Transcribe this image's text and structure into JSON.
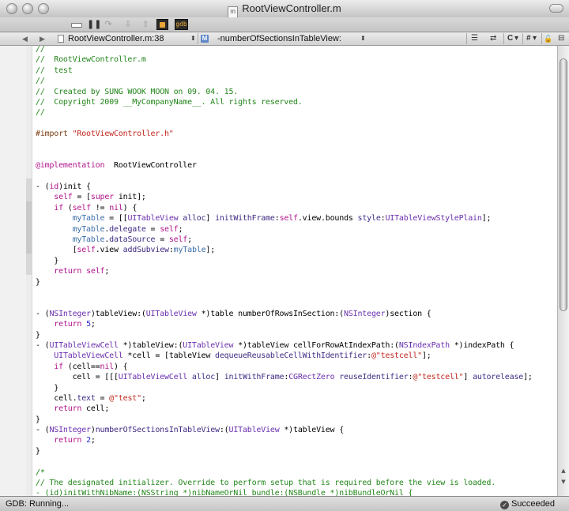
{
  "window": {
    "title": "RootViewController.m",
    "title_doc_badge": "m"
  },
  "toolbar": {
    "broom_icon": "clear-console-icon",
    "pause_glyph": "❚❚",
    "step_over_glyph": "↷",
    "step_into_glyph": "⇩",
    "step_out_glyph": "⇧",
    "gdb_label": "gdb"
  },
  "navbar": {
    "back_glyph": "◀",
    "forward_glyph": "▶",
    "file_label": "RootViewController.m:38",
    "popup_caret": "⬍",
    "method_badge": "M",
    "function_label": "-numberOfSectionsInTableView:",
    "counterparts_glyph": "⇄",
    "bookmarks_glyph": "☰",
    "language_label": "C",
    "pragma_label": "#",
    "lock_glyph": "🔓",
    "split_glyph": "⊟",
    "dropdown_glyph": "▾"
  },
  "editor": {
    "lines": [
      [
        [
          "c",
          "//"
        ]
      ],
      [
        [
          "c",
          "//  RootViewController.m"
        ]
      ],
      [
        [
          "c",
          "//  test"
        ]
      ],
      [
        [
          "c",
          "//"
        ]
      ],
      [
        [
          "c",
          "//  Created by SUNG WOOK MOON on 09. 04. 15."
        ]
      ],
      [
        [
          "c",
          "//  Copyright 2009 __MyCompanyName__. All rights reserved."
        ]
      ],
      [
        [
          "c",
          "//"
        ]
      ],
      [],
      [
        [
          "p",
          "#import "
        ],
        [
          "s",
          "\"RootViewController.h\""
        ]
      ],
      [],
      [],
      [
        [
          "k",
          "@implementation"
        ],
        [
          "",
          "  RootViewController"
        ]
      ],
      [],
      [
        [
          "",
          "- ("
        ],
        [
          "k",
          "id"
        ],
        [
          "",
          ")init {"
        ]
      ],
      [
        [
          "",
          "    "
        ],
        [
          "k",
          "self"
        ],
        [
          "",
          " = ["
        ],
        [
          "k",
          "super"
        ],
        [
          "",
          " init];"
        ]
      ],
      [
        [
          "",
          "    "
        ],
        [
          "k",
          "if"
        ],
        [
          "",
          " ("
        ],
        [
          "k",
          "self"
        ],
        [
          "",
          " != "
        ],
        [
          "k",
          "nil"
        ],
        [
          "",
          ") {"
        ]
      ],
      [
        [
          "",
          "        "
        ],
        [
          "v",
          "myTable"
        ],
        [
          "",
          " = [["
        ],
        [
          "t",
          "UITableView"
        ],
        [
          "",
          ""
        ],
        [
          "",
          " "
        ],
        [
          "m",
          "alloc"
        ],
        [
          "",
          "] "
        ],
        [
          "m",
          "initWithFrame"
        ],
        [
          "",
          ":"
        ],
        [
          "k",
          "self"
        ],
        [
          "",
          ".view.bounds "
        ],
        [
          "m",
          "style"
        ],
        [
          "",
          ":"
        ],
        [
          "t",
          "UITableViewStylePlain"
        ],
        [
          "",
          "];"
        ]
      ],
      [
        [
          "",
          "        "
        ],
        [
          "v",
          "myTable"
        ],
        [
          "",
          "."
        ],
        [
          "m",
          "delegate"
        ],
        [
          "",
          " = "
        ],
        [
          "k",
          "self"
        ],
        [
          "",
          ";"
        ]
      ],
      [
        [
          "",
          "        "
        ],
        [
          "v",
          "myTable"
        ],
        [
          "",
          "."
        ],
        [
          "m",
          "dataSource"
        ],
        [
          "",
          " = "
        ],
        [
          "k",
          "self"
        ],
        [
          "",
          ";"
        ]
      ],
      [
        [
          "",
          "        ["
        ],
        [
          "k",
          "self"
        ],
        [
          "",
          ".view "
        ],
        [
          "m",
          "addSubview"
        ],
        [
          "",
          ":"
        ],
        [
          "v",
          "myTable"
        ],
        [
          "",
          "];"
        ]
      ],
      [
        [
          "",
          "    }"
        ]
      ],
      [
        [
          "",
          "    "
        ],
        [
          "k",
          "return"
        ],
        [
          "",
          " "
        ],
        [
          "k",
          "self"
        ],
        [
          "",
          ";"
        ]
      ],
      [
        [
          "",
          "}"
        ]
      ],
      [],
      [],
      [
        [
          "",
          "- ("
        ],
        [
          "t",
          "NSInteger"
        ],
        [
          "",
          ")tableView:("
        ],
        [
          "t",
          "UITableView"
        ],
        [
          "",
          " *)table numberOfRowsInSection:("
        ],
        [
          "t",
          "NSInteger"
        ],
        [
          "",
          ")section {"
        ]
      ],
      [
        [
          "",
          "    "
        ],
        [
          "k",
          "return"
        ],
        [
          "",
          " "
        ],
        [
          "n",
          "5"
        ],
        [
          "",
          ";"
        ]
      ],
      [
        [
          "",
          "}"
        ]
      ],
      [
        [
          "",
          "- ("
        ],
        [
          "t",
          "UITableViewCell"
        ],
        [
          "",
          " *)tableView:("
        ],
        [
          "t",
          "UITableView"
        ],
        [
          "",
          " *)tableView cellForRowAtIndexPath:("
        ],
        [
          "t",
          "NSIndexPath"
        ],
        [
          "",
          " *)indexPath {"
        ]
      ],
      [
        [
          "",
          "    "
        ],
        [
          "t",
          "UITableViewCell"
        ],
        [
          "",
          " *cell = [tableView "
        ],
        [
          "m",
          "dequeueReusableCellWithIdentifier"
        ],
        [
          "",
          ":"
        ],
        [
          "s",
          "@\"testcell\""
        ],
        [
          "",
          "];"
        ]
      ],
      [
        [
          "",
          "    "
        ],
        [
          "k",
          "if"
        ],
        [
          "",
          " (cell=="
        ],
        [
          "k",
          "nil"
        ],
        [
          "",
          ") {"
        ]
      ],
      [
        [
          "",
          "        cell = [[["
        ],
        [
          "t",
          "UITableViewCell"
        ],
        [
          "",
          " "
        ],
        [
          "m",
          "alloc"
        ],
        [
          "",
          "] "
        ],
        [
          "m",
          "initWithFrame"
        ],
        [
          "",
          ":"
        ],
        [
          "t",
          "CGRectZero"
        ],
        [
          "",
          " "
        ],
        [
          "m",
          "reuseIdentifier"
        ],
        [
          "",
          ":"
        ],
        [
          "s",
          "@\"testcell\""
        ],
        [
          "",
          "] "
        ],
        [
          "m",
          "autorelease"
        ],
        [
          "",
          "];"
        ]
      ],
      [
        [
          "",
          "    }"
        ]
      ],
      [
        [
          "",
          "    cell."
        ],
        [
          "m",
          "text"
        ],
        [
          "",
          " = "
        ],
        [
          "s",
          "@\"test\""
        ],
        [
          "",
          ";"
        ]
      ],
      [
        [
          "",
          "    "
        ],
        [
          "k",
          "return"
        ],
        [
          "",
          " cell;"
        ]
      ],
      [
        [
          "",
          "}"
        ]
      ],
      [
        [
          "",
          "- ("
        ],
        [
          "t",
          "NSInteger"
        ],
        [
          "",
          ")"
        ],
        [
          "m",
          "numberOfSectionsInTableView"
        ],
        [
          "",
          ":("
        ],
        [
          "t",
          "UITableView"
        ],
        [
          "",
          " *)tableView {"
        ]
      ],
      [
        [
          "",
          "    "
        ],
        [
          "k",
          "return"
        ],
        [
          "",
          " "
        ],
        [
          "n",
          "2"
        ],
        [
          "",
          ";"
        ]
      ],
      [
        [
          "",
          "}"
        ]
      ],
      [],
      [
        [
          "c",
          "/*"
        ]
      ],
      [
        [
          "c",
          "// The designated initializer. Override to perform setup that is required before the view is loaded."
        ]
      ],
      [
        [
          "c",
          "- (id)initWithNibName:(NSString *)nibNameOrNil bundle:(NSBundle *)nibBundleOrNil {"
        ]
      ]
    ]
  },
  "status": {
    "left": "GDB: Running...",
    "right": "Succeeded",
    "right_icon": "✓"
  }
}
